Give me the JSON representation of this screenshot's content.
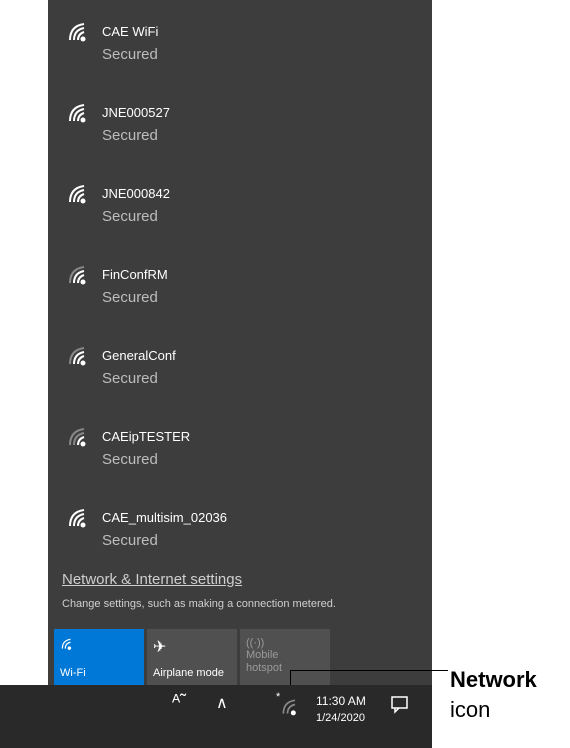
{
  "networks": [
    {
      "name": "CAE WiFi",
      "status": "Secured"
    },
    {
      "name": "JNE000527",
      "status": "Secured"
    },
    {
      "name": "JNE000842",
      "status": "Secured"
    },
    {
      "name": "FinConfRM",
      "status": "Secured"
    },
    {
      "name": "GeneralConf",
      "status": "Secured"
    },
    {
      "name": "CAEipTESTER",
      "status": "Secured"
    },
    {
      "name": "CAE_multisim_02036",
      "status": "Secured"
    }
  ],
  "settings": {
    "link": "Network & Internet settings",
    "description": "Change settings, such as making a connection metered."
  },
  "tiles": {
    "wifi": {
      "label": "Wi-Fi",
      "icon": "wifi-icon",
      "color": "#0078d7"
    },
    "airplane": {
      "label": "Airplane mode",
      "icon": "airplane-icon",
      "color": "#505050"
    },
    "hotspot": {
      "label": "Mobile hotspot",
      "icon": "hotspot-icon",
      "color": "#505050"
    }
  },
  "taskbar": {
    "time": "11:30 AM",
    "date": "1/24/2020",
    "icons": [
      "people-icon",
      "chevron-up-icon",
      "network-icon",
      "action-center-icon"
    ]
  },
  "callout": {
    "line1": "Network",
    "line2": "icon"
  }
}
